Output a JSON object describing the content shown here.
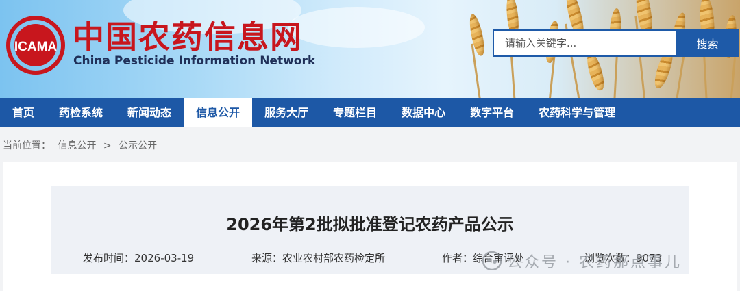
{
  "header": {
    "logo_text": "ICAMA",
    "site_title": "中国农药信息网",
    "site_subtitle": "China Pesticide Information Network"
  },
  "search": {
    "placeholder": "请输入关键字...",
    "button_label": "搜索"
  },
  "nav": {
    "items": [
      {
        "label": "首页"
      },
      {
        "label": "药检系统"
      },
      {
        "label": "新闻动态"
      },
      {
        "label": "信息公开"
      },
      {
        "label": "服务大厅"
      },
      {
        "label": "专题栏目"
      },
      {
        "label": "数据中心"
      },
      {
        "label": "数字平台"
      },
      {
        "label": "农药科学与管理"
      }
    ],
    "active_index": 3
  },
  "breadcrumb": {
    "prefix": "当前位置：",
    "items": [
      "信息公开",
      "公示公开"
    ],
    "separator": ">"
  },
  "article": {
    "title": "2026年第2批拟批准登记农药产品公示",
    "publish_label": "发布时间：",
    "publish_date": "2026-03-19",
    "source_label": "来源：",
    "source": "农业农村部农药检定所",
    "author_label": "作者：",
    "author": "综合审评处",
    "views_label": "浏览次数：",
    "views": "9073"
  },
  "watermark": {
    "text": "公众号 · 农药那点事儿"
  },
  "colors": {
    "brand_red": "#c8161d",
    "nav_blue": "#1d58a6",
    "search_blue": "#1e5aa8"
  }
}
